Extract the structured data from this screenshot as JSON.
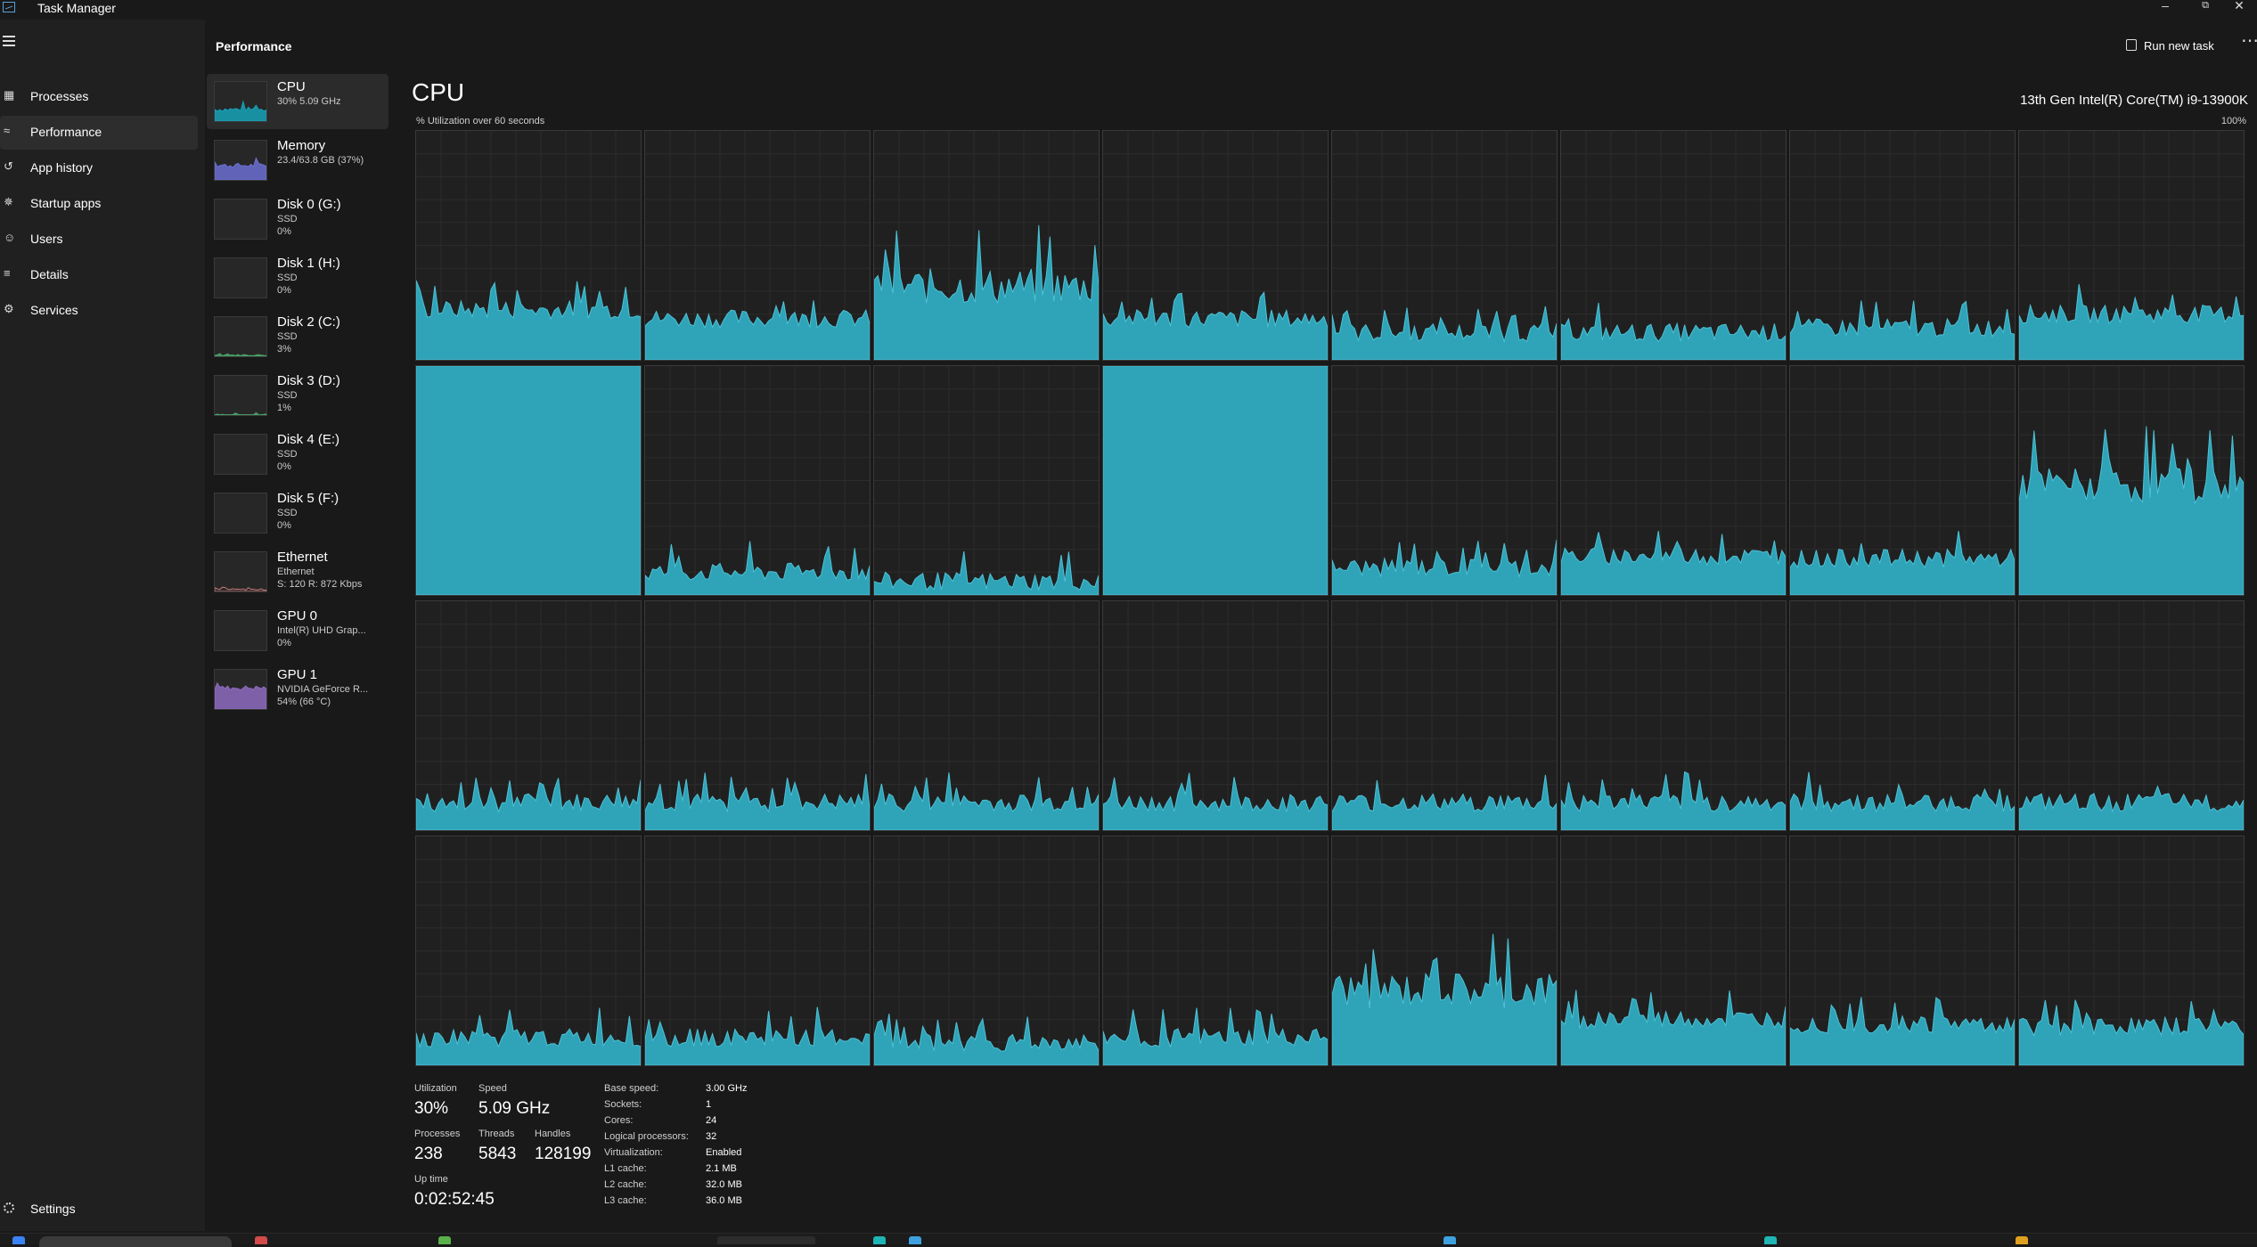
{
  "window": {
    "title": "Task Manager"
  },
  "nav": {
    "items": [
      {
        "label": "Processes",
        "icon": "processes-icon"
      },
      {
        "label": "Performance",
        "icon": "performance-icon",
        "active": true
      },
      {
        "label": "App history",
        "icon": "app-history-icon"
      },
      {
        "label": "Startup apps",
        "icon": "startup-apps-icon"
      },
      {
        "label": "Users",
        "icon": "users-icon"
      },
      {
        "label": "Details",
        "icon": "details-icon"
      },
      {
        "label": "Services",
        "icon": "services-icon"
      }
    ],
    "settings_label": "Settings"
  },
  "header": {
    "section_title": "Performance",
    "run_new_task": "Run new task",
    "more_glyph": "⋯"
  },
  "devices": [
    {
      "name": "CPU",
      "sub1": "30%  5.09 GHz",
      "sub2": "",
      "color": "#17a2b8",
      "level": 0.3,
      "active": true
    },
    {
      "name": "Memory",
      "sub1": "23.4/63.8 GB (37%)",
      "sub2": "",
      "color": "#6b6fd1",
      "level": 0.37
    },
    {
      "name": "Disk 0 (G:)",
      "sub1": "SSD",
      "sub2": "0%",
      "color": "#4aa56a",
      "level": 0
    },
    {
      "name": "Disk 1 (H:)",
      "sub1": "SSD",
      "sub2": "0%",
      "color": "#4aa56a",
      "level": 0
    },
    {
      "name": "Disk 2 (C:)",
      "sub1": "SSD",
      "sub2": "3%",
      "color": "#4aa56a",
      "level": 0.03
    },
    {
      "name": "Disk 3 (D:)",
      "sub1": "SSD",
      "sub2": "1%",
      "color": "#4aa56a",
      "level": 0.01
    },
    {
      "name": "Disk 4 (E:)",
      "sub1": "SSD",
      "sub2": "0%",
      "color": "#4aa56a",
      "level": 0
    },
    {
      "name": "Disk 5 (F:)",
      "sub1": "SSD",
      "sub2": "0%",
      "color": "#4aa56a",
      "level": 0
    },
    {
      "name": "Ethernet",
      "sub1": "Ethernet",
      "sub2": "S: 120  R: 872 Kbps",
      "color": "#c97a7a",
      "level": 0.05
    },
    {
      "name": "GPU 0",
      "sub1": "Intel(R) UHD Grap...",
      "sub2": "0%",
      "color": "#8e6bbf",
      "level": 0
    },
    {
      "name": "GPU 1",
      "sub1": "NVIDIA GeForce R...",
      "sub2": "54%  (66 °C)",
      "color": "#8e6bbf",
      "level": 0.54
    }
  ],
  "cpu": {
    "title": "CPU",
    "model": "13th Gen Intel(R) Core(TM) i9-13900K",
    "util_label": "% Utilization over 60 seconds",
    "util_max": "100%",
    "graph_fill": "#2fa3b8",
    "graph_line": "#4dc2d6",
    "grid_color": "#2c2c2c",
    "core_levels": [
      [
        0.22,
        0.18,
        0.32,
        0.18,
        0.12,
        0.12,
        0.14,
        0.2
      ],
      [
        1.0,
        0.1,
        0.06,
        1.0,
        0.12,
        0.17,
        0.16,
        0.48
      ],
      [
        0.12,
        0.12,
        0.12,
        0.12,
        0.12,
        0.12,
        0.12,
        0.12
      ],
      [
        0.12,
        0.12,
        0.1,
        0.12,
        0.32,
        0.2,
        0.18,
        0.17
      ]
    ]
  },
  "stats": {
    "utilization_label": "Utilization",
    "utilization": "30%",
    "speed_label": "Speed",
    "speed": "5.09 GHz",
    "processes_label": "Processes",
    "processes": "238",
    "threads_label": "Threads",
    "threads": "5843",
    "handles_label": "Handles",
    "handles": "128199",
    "uptime_label": "Up time",
    "uptime": "0:02:52:45"
  },
  "specs": [
    {
      "key": "Base speed:",
      "value": "3.00 GHz"
    },
    {
      "key": "Sockets:",
      "value": "1"
    },
    {
      "key": "Cores:",
      "value": "24"
    },
    {
      "key": "Logical processors:",
      "value": "32"
    },
    {
      "key": "Virtualization:",
      "value": "Enabled"
    },
    {
      "key": "L1 cache:",
      "value": "2.1 MB"
    },
    {
      "key": "L2 cache:",
      "value": "32.0 MB"
    },
    {
      "key": "L3 cache:",
      "value": "36.0 MB"
    }
  ]
}
